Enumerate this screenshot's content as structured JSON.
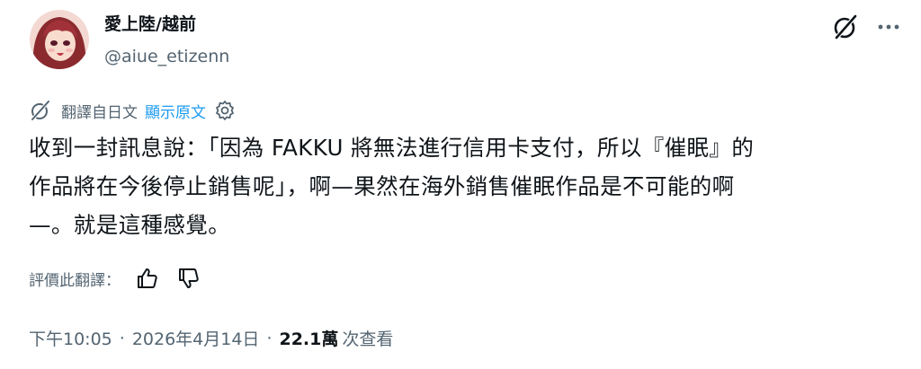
{
  "author": {
    "display_name": "愛上陸/越前",
    "handle": "@aiue_etizenn"
  },
  "header": {
    "grok_icon": "grok-icon",
    "more_icon": "more-horizontal-icon"
  },
  "translation": {
    "label": "翻譯自日文",
    "show_original": "顯示原文",
    "icon": "translate-icon",
    "settings_icon": "gear-icon"
  },
  "tweet": {
    "lines": [
      "收到一封訊息說：「因為 FAKKU 將無法進行信用卡支付，所以『催眠』的",
      "作品將在今後停止銷售呢」，啊—果然在海外銷售催眠作品是不可能的啊",
      "—。就是這種感覺。"
    ]
  },
  "rating": {
    "label": "評價此翻譯：",
    "thumbs_up_icon": "thumbs-up-icon",
    "thumbs_down_icon": "thumbs-down-icon"
  },
  "meta": {
    "time": "下午10:05",
    "separator": "·",
    "date": "2026年4月14日",
    "views_count": "22.1萬",
    "views_label": "次查看"
  },
  "colors": {
    "text": "#0f1419",
    "secondary": "#536471",
    "link": "#1d9bf0"
  }
}
